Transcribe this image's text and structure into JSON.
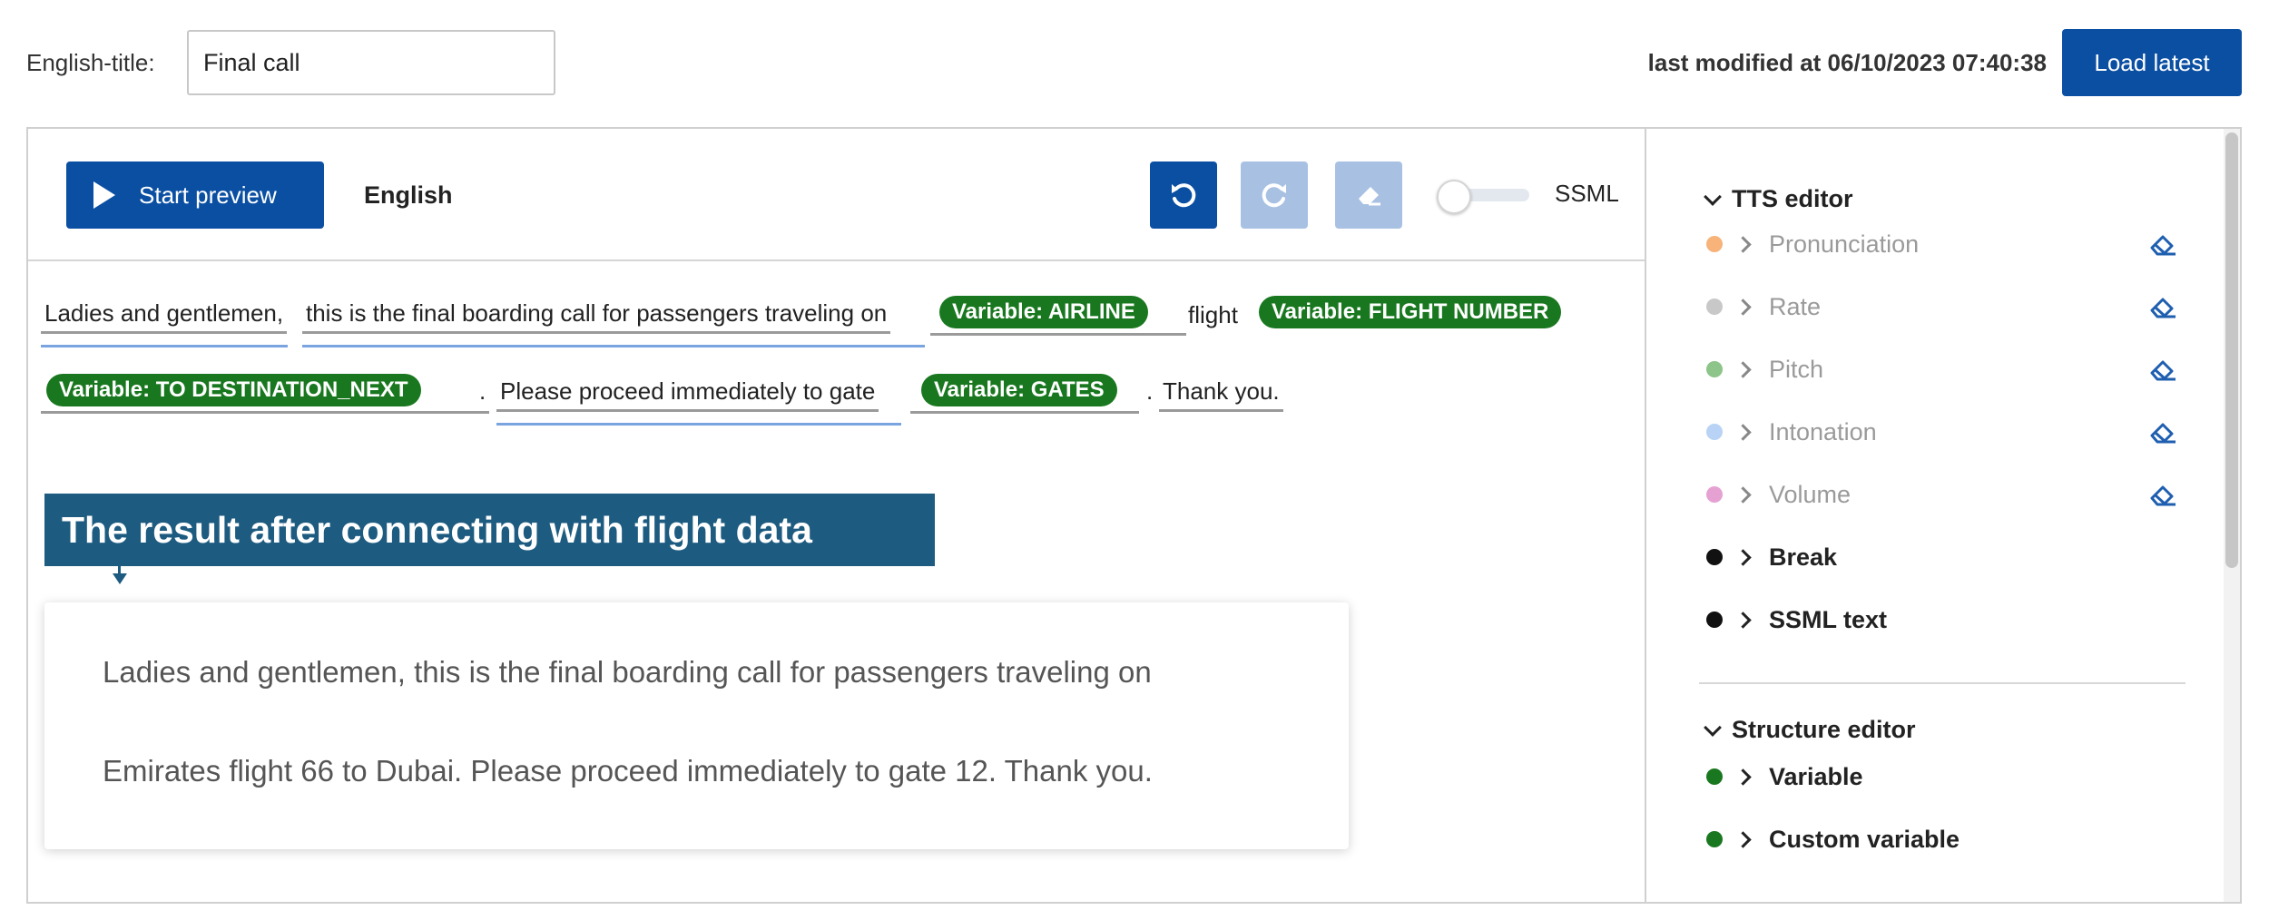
{
  "header": {
    "title_label": "English-title:",
    "title_value": "Final call",
    "last_modified": "last modified at 06/10/2023 07:40:38",
    "load_latest_label": "Load latest"
  },
  "toolbar": {
    "preview_label": "Start preview",
    "language": "English",
    "undo_icon": "undo-icon",
    "redo_icon": "redo-icon",
    "erase_icon": "eraser-icon",
    "ssml_label": "SSML",
    "ssml_enabled": false
  },
  "editor": {
    "segments": {
      "s1": "Ladies and gentlemen,",
      "s2": "this is the final boarding call for passengers traveling on",
      "s3": "flight",
      "s4": ".",
      "s5": "Please proceed immediately to gate",
      "s6": ".",
      "s7": "Thank you."
    },
    "variables": {
      "v1": "Variable: AIRLINE",
      "v2": "Variable: FLIGHT NUMBER",
      "v3": "Variable: TO DESTINATION_NEXT",
      "v4": "Variable: GATES"
    }
  },
  "callout": {
    "title": "The result after connecting with flight data",
    "line1": "Ladies and gentlemen, this is the final boarding call for passengers traveling on",
    "line2": "Emirates flight 66 to Dubai. Please proceed immediately to gate 12. Thank you."
  },
  "side_panel": {
    "tts_title": "TTS editor",
    "tts_items": [
      {
        "label": "Pronunciation",
        "color": "#f7b37a"
      },
      {
        "label": "Rate",
        "color": "#c8c8c8"
      },
      {
        "label": "Pitch",
        "color": "#8cc48a"
      },
      {
        "label": "Intonation",
        "color": "#b8d3f5"
      },
      {
        "label": "Volume",
        "color": "#e6a1d3"
      },
      {
        "label": "Break",
        "color": "#111111"
      },
      {
        "label": "SSML text",
        "color": "#111111"
      }
    ],
    "structure_title": "Structure editor",
    "structure_items": [
      {
        "label": "Variable",
        "color": "#19781f"
      },
      {
        "label": "Custom variable",
        "color": "#19781f"
      }
    ]
  },
  "colors": {
    "primary": "#0b4fa3",
    "primary_disabled": "#a8c1e3",
    "variable_chip": "#19781f",
    "callout": "#1d5b80",
    "underline_blue": "#7aa4e0"
  }
}
